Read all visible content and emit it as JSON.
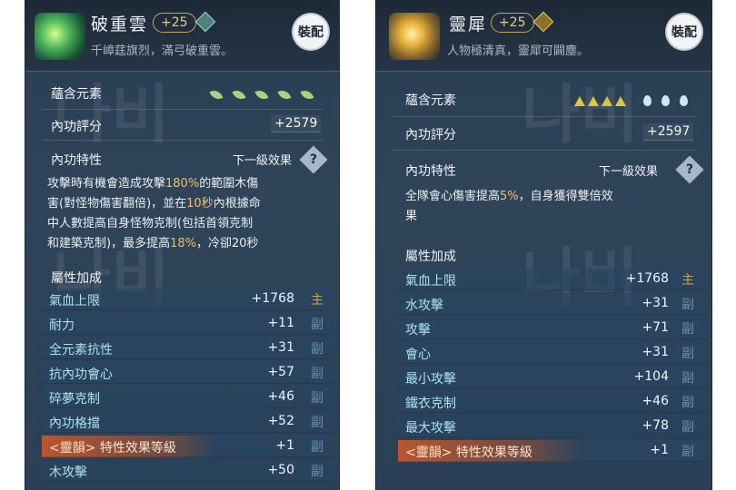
{
  "left": {
    "name": "破重雲",
    "level": "+25",
    "desc": "千嶂莛旗烈，滿弓破重雲。",
    "equip": "裝配",
    "elements_label": "蘊含元素",
    "score_label": "內功評分",
    "score": "+2579",
    "trait_label": "內功特性",
    "next_label": "下一級效果",
    "q": "?",
    "para": {
      "l1a": "攻擊時有機會造成攻擊",
      "l1h": "180%",
      "l1b": "的範圍木傷",
      "l2a": "害(對怪物傷害翻倍)，並在",
      "l2h": "10秒",
      "l2b": "內根據命",
      "l3": "中人數提高自身怪物克制(包括首領克制",
      "l4a": "和建築克制)，最多提高",
      "l4h": "18%",
      "l4b": "，冷卻20秒"
    },
    "attr_title": "屬性加成",
    "rows": [
      {
        "label": "氣血上限",
        "value": "+1768",
        "tag": "主"
      },
      {
        "label": "耐力",
        "value": "+11",
        "tag": "副"
      },
      {
        "label": "全元素抗性",
        "value": "+31",
        "tag": "副"
      },
      {
        "label": "抗內功會心",
        "value": "+57",
        "tag": "副"
      },
      {
        "label": "碎夢克制",
        "value": "+46",
        "tag": "副"
      },
      {
        "label": "內功格擋",
        "value": "+52",
        "tag": "副"
      },
      {
        "label": "<靈韻> 特性效果等級",
        "value": "+1",
        "tag": "副"
      },
      {
        "label": "木攻擊",
        "value": "+50",
        "tag": "副"
      }
    ]
  },
  "right": {
    "name": "靈犀",
    "level": "+25",
    "desc": "人物極清真，靈犀可闢塵。",
    "equip": "裝配",
    "elements_label": "蘊含元素",
    "score_label": "內功評分",
    "score": "+2597",
    "trait_label": "內功特性",
    "next_label": "下一級效果",
    "q": "?",
    "para": {
      "l1a": "全隊會心傷害提高",
      "l1h": "5%",
      "l1b": "，自身獲得雙倍效",
      "l2": "果"
    },
    "attr_title": "屬性加成",
    "rows": [
      {
        "label": "氣血上限",
        "value": "+1768",
        "tag": "主"
      },
      {
        "label": "水攻擊",
        "value": "+31",
        "tag": "副"
      },
      {
        "label": "攻擊",
        "value": "+71",
        "tag": "副"
      },
      {
        "label": "會心",
        "value": "+31",
        "tag": "副"
      },
      {
        "label": "最小攻擊",
        "value": "+104",
        "tag": "副"
      },
      {
        "label": "鐵衣克制",
        "value": "+46",
        "tag": "副"
      },
      {
        "label": "最大攻擊",
        "value": "+78",
        "tag": "副"
      },
      {
        "label": "<靈韻> 特性效果等級",
        "value": "+1",
        "tag": "副"
      }
    ]
  },
  "watermark": "나비"
}
